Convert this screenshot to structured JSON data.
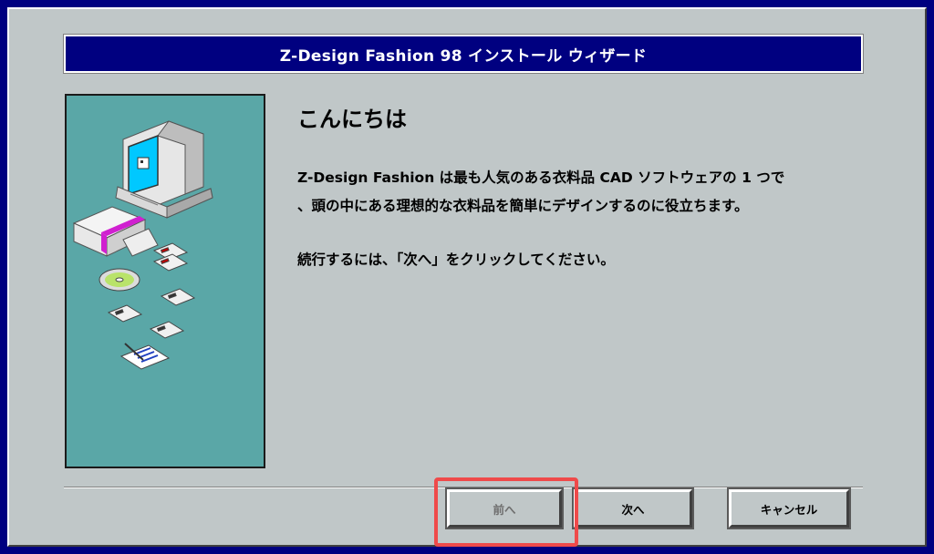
{
  "window": {
    "title": "Z-Design Fashion 98 インストール ウィザード"
  },
  "main": {
    "heading": "こんにちは",
    "description_line1": "Z-Design Fashion は最も人気のある衣料品 CAD ソフトウェアの 1 つで",
    "description_line2": "、頭の中にある理想的な衣料品を簡単にデザインするのに役立ちます。",
    "instruction": "続行するには、「次へ」をクリックしてください。"
  },
  "buttons": {
    "back": {
      "label": "前へ",
      "enabled": false,
      "highlighted": true
    },
    "next": {
      "label": "次へ",
      "enabled": true
    },
    "cancel": {
      "label": "キャンセル",
      "enabled": true
    }
  },
  "illustration": {
    "icon": "computer-with-software-disks-icon",
    "colors": {
      "background": "#5aa7a7",
      "monitor_screen": "#00c8ff",
      "box_stripe": "#d020d0"
    }
  },
  "colors": {
    "desktop": "#000080",
    "title_bar": "#000080",
    "window_face": "#c0c7c8",
    "highlight": "#ef4a4a"
  }
}
